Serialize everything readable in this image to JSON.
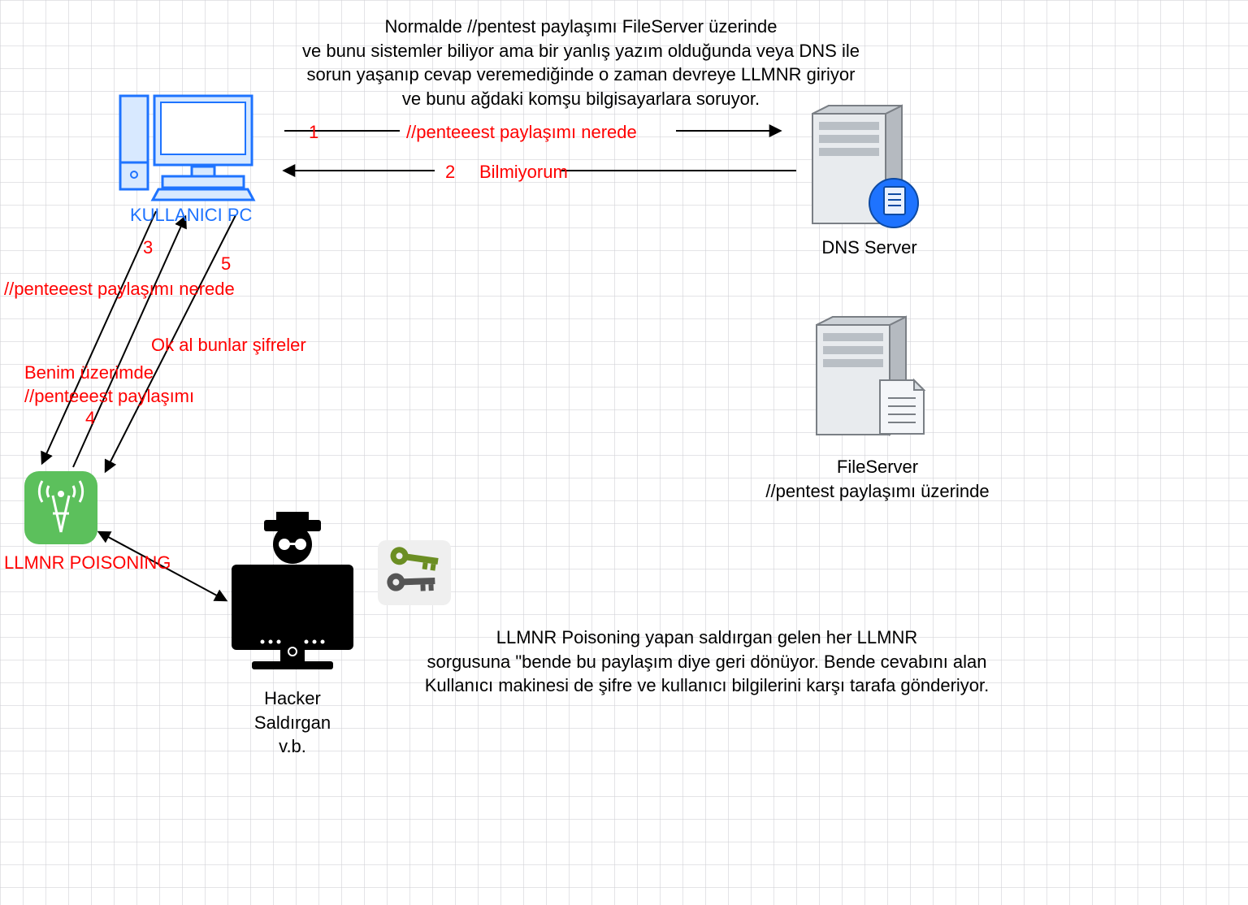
{
  "top_paragraph": {
    "l1": "Normalde //pentest paylaşımı FileServer üzerinde",
    "l2": "ve bunu sistemler biliyor ama bir yanlış yazım olduğunda veya DNS ile",
    "l3": "sorun yaşanıp cevap veremediğinde o zaman devreye LLMNR giriyor",
    "l4": "ve bunu ağdaki komşu bilgisayarlara soruyor."
  },
  "arrows": {
    "a1_num": "1",
    "a1_label": "//penteeest paylaşımı nerede",
    "a2_num": "2",
    "a2_label": "Bilmiyorum",
    "a3_num": "3",
    "a3_label": "//penteeest paylaşımı nerede",
    "a4_num": "4",
    "a4_label_l1": "Benim üzerimde",
    "a4_label_l2": "//penteeest paylaşımı",
    "a5_num": "5",
    "a5_label": "Ok al bunlar şifreler"
  },
  "nodes": {
    "user_pc": "KULLANICI PC",
    "dns": "DNS Server",
    "fileserver_l1": "FileServer",
    "fileserver_l2": "//pentest paylaşımı üzerinde",
    "llmnr": "LLMNR POISONING",
    "hacker_l1": "Hacker",
    "hacker_l2": "Saldırgan",
    "hacker_l3": "v.b."
  },
  "bottom_paragraph": {
    "l1": "LLMNR Poisoning yapan saldırgan gelen her LLMNR",
    "l2": "sorgusuna \"bende bu paylaşım diye geri dönüyor. Bende cevabını alan",
    "l3": "Kullanıcı makinesi de şifre ve kullanıcı bilgilerini karşı tarafa gönderiyor."
  },
  "colors": {
    "red": "#ff0000",
    "blue": "#1e73ff",
    "green": "#5cc05c",
    "key_green": "#6b8e23"
  }
}
